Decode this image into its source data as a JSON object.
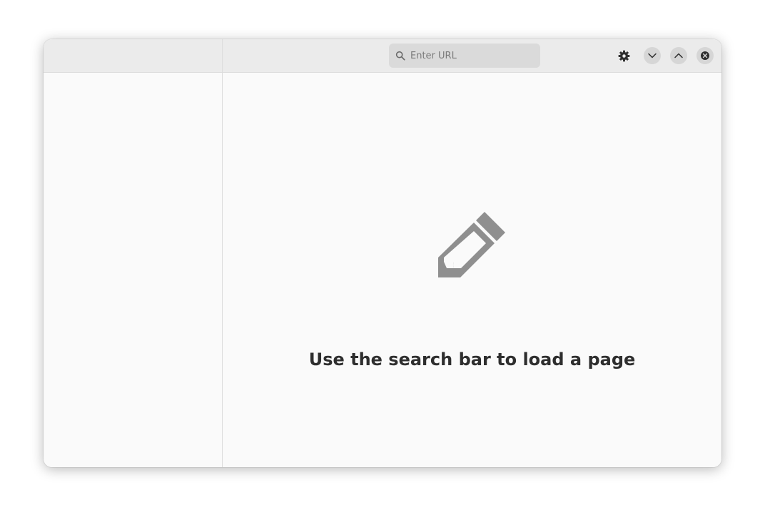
{
  "header": {
    "search": {
      "placeholder": "Enter URL",
      "value": ""
    },
    "icons": {
      "search": "search-icon",
      "settings": "gear-icon",
      "minimize": "chevron-down-icon",
      "maximize": "chevron-up-icon",
      "close": "close-icon"
    }
  },
  "status_page": {
    "icon": "pencil-icon",
    "title": "Use the search bar to load a page"
  },
  "colors": {
    "header_bg": "#ebebeb",
    "window_bg": "#fafafa",
    "icon_gray": "#8f8f8f",
    "title_text": "#2e2e2e"
  }
}
